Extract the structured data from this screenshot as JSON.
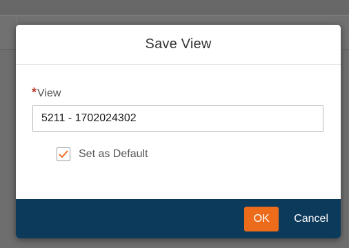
{
  "dialog": {
    "title": "Save View",
    "field": {
      "required_marker": "*",
      "label": "View",
      "value": "5211 - 1702024302"
    },
    "default_option": {
      "label": "Set as Default",
      "checked": true
    },
    "footer": {
      "ok_label": "OK",
      "cancel_label": "Cancel"
    }
  },
  "colors": {
    "footer_bg": "#0c3a5b",
    "ok_button": "#ec6c1c",
    "required_star": "#c0392b",
    "checkmark": "#ec6c1c"
  },
  "icons": {
    "checkbox": "checkmark-icon"
  }
}
